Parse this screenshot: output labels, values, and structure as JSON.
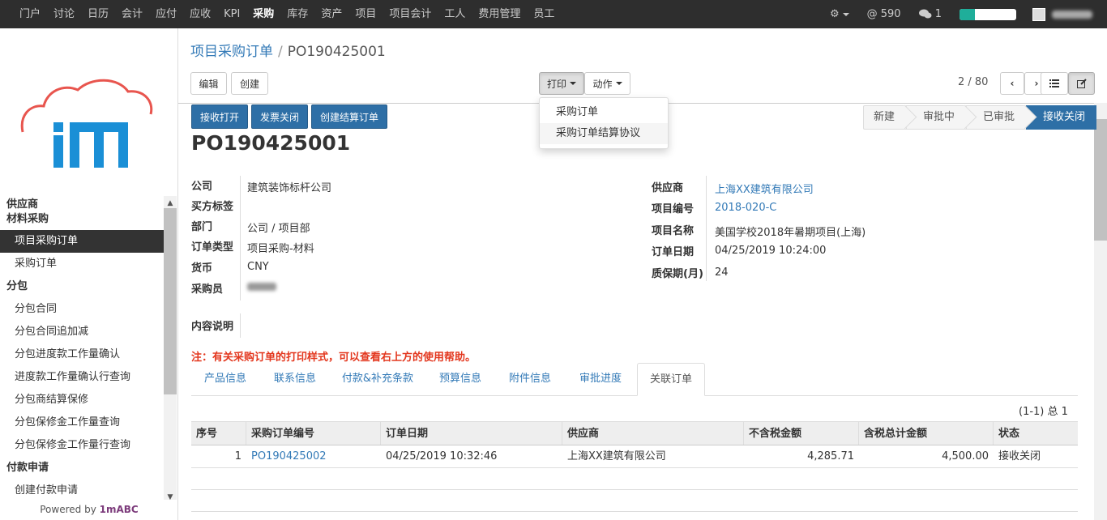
{
  "topnav": {
    "items": [
      "门户",
      "讨论",
      "日历",
      "会计",
      "应付",
      "应收",
      "KPI",
      "采购",
      "库存",
      "资产",
      "项目",
      "项目会计",
      "工人",
      "费用管理",
      "员工"
    ],
    "active_index": 7
  },
  "topright": {
    "mentions_count": "590",
    "messages_count": "1",
    "progress_fraction": 0.27
  },
  "sidebar": {
    "sections": [
      {
        "header": "供应商",
        "items": []
      },
      {
        "header": "材料采购",
        "items": [
          "项目采购订单",
          "采购订单"
        ]
      },
      {
        "header": "分包",
        "items": [
          "分包合同",
          "分包合同追加减",
          "分包进度款工作量确认",
          "进度款工作量确认行查询",
          "分包商结算保修",
          "分包保修金工作量查询",
          "分包保修金工作量行查询"
        ]
      },
      {
        "header": "付款申请",
        "items": [
          "创建付款申请"
        ]
      }
    ],
    "active_item": "项目采购订单",
    "powered_prefix": "Powered by",
    "powered_brand": "1mABC"
  },
  "breadcrumb": {
    "parent": "项目采购订单",
    "separator": "/",
    "current": "PO190425001"
  },
  "toolbar": {
    "edit_label": "编辑",
    "create_label": "创建",
    "print_label": "打印",
    "action_label": "动作",
    "pager_text": "2 / 80"
  },
  "print_menu": {
    "items": [
      "采购订单",
      "采购订单结算协议"
    ]
  },
  "status_buttons": [
    "接收打开",
    "发票关闭",
    "创建结算订单"
  ],
  "stages": {
    "items": [
      "新建",
      "审批中",
      "已审批",
      "接收关闭"
    ],
    "active_index": 3
  },
  "form": {
    "title": "PO190425001",
    "left_fields": [
      {
        "label": "公司",
        "value": "建筑装饰标杆公司"
      },
      {
        "label": "买方标签",
        "value": ""
      },
      {
        "label": "部门",
        "value": "公司 / 项目部"
      },
      {
        "label": "订单类型",
        "value": "项目采购-材料"
      },
      {
        "label": "货币",
        "value": "CNY"
      },
      {
        "label": "采购员",
        "value": ""
      }
    ],
    "right_fields": [
      {
        "label": "供应商",
        "value": "上海XX建筑有限公司",
        "link": true
      },
      {
        "label": "项目编号",
        "value": "2018-020-C",
        "link": true
      },
      {
        "label": "项目名称",
        "value": "美国学校2018年暑期项目(上海)",
        "link": false
      },
      {
        "label": "订单日期",
        "value": "04/25/2019 10:24:00",
        "link": false
      },
      {
        "label": "质保期(月)",
        "value": "24",
        "link": false
      }
    ],
    "description_label": "内容说明",
    "note": "注：有关采购订单的打印样式，可以查看右上方的使用帮助。"
  },
  "tabs": {
    "items": [
      "产品信息",
      "联系信息",
      "付款&补充条款",
      "预算信息",
      "附件信息",
      "审批进度",
      "关联订单"
    ],
    "active_index": 6
  },
  "related_orders": {
    "count_text": "(1-1) 总 1",
    "columns": [
      "序号",
      "采购订单编号",
      "订单日期",
      "供应商",
      "不含税金额",
      "含税总计金额",
      "状态"
    ],
    "rows": [
      [
        "1",
        "PO190425002",
        "04/25/2019 10:32:46",
        "上海XX建筑有限公司",
        "4,285.71",
        "4,500.00",
        "接收关闭"
      ]
    ]
  },
  "colors": {
    "topbar_bg": "#2e2e2e",
    "primary": "#2e6fa6",
    "link": "#337ab7",
    "note": "#e3371e",
    "logo_red": "#e8554e",
    "logo_blue": "#1a8fd6"
  }
}
